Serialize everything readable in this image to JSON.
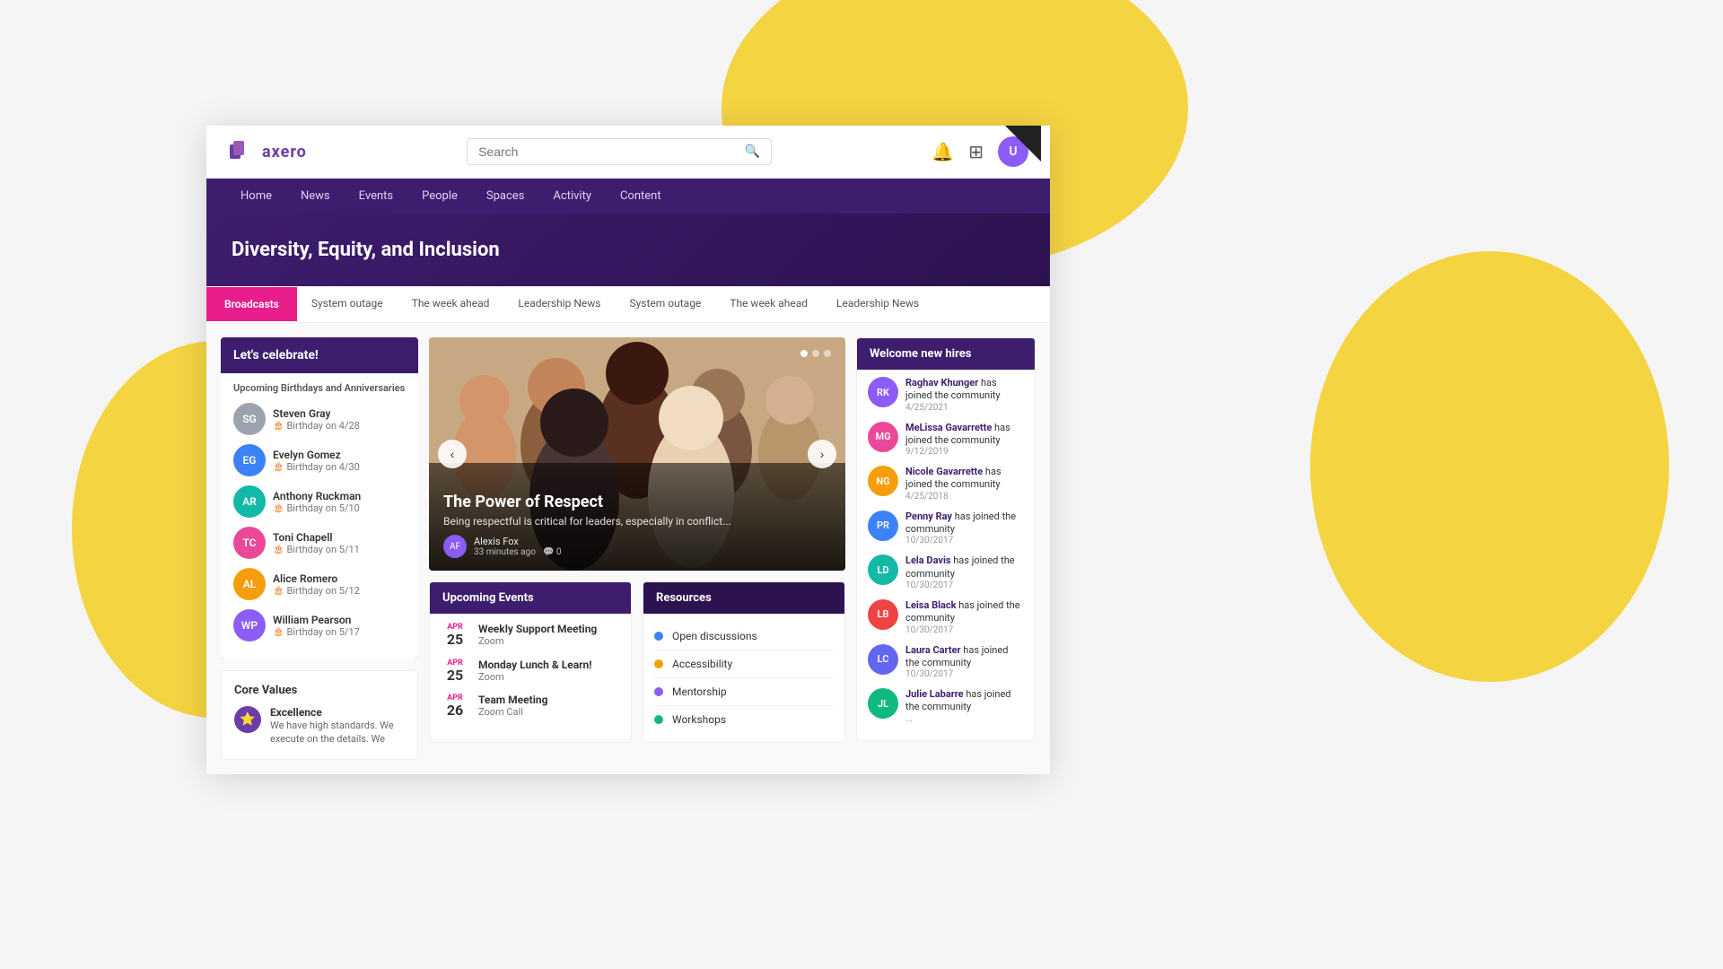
{
  "background": {
    "shape_top": "decorative yellow circle top",
    "shape_right": "decorative yellow blob right",
    "shape_left": "decorative yellow blob left"
  },
  "topbar": {
    "logo_text": "axero",
    "search_placeholder": "Search",
    "search_label": "Search",
    "notification_icon": "bell-icon",
    "add_icon": "add-icon",
    "user_avatar": "user-avatar"
  },
  "navbar": {
    "items": [
      {
        "label": "Home",
        "href": "#"
      },
      {
        "label": "News",
        "href": "#"
      },
      {
        "label": "Events",
        "href": "#"
      },
      {
        "label": "People",
        "href": "#"
      },
      {
        "label": "Spaces",
        "href": "#"
      },
      {
        "label": "Activity",
        "href": "#"
      },
      {
        "label": "Content",
        "href": "#"
      }
    ]
  },
  "hero": {
    "title": "Diversity, Equity, and Inclusion"
  },
  "broadcasts_bar": {
    "tabs": [
      {
        "label": "Broadcasts",
        "active": true
      },
      {
        "label": "System outage",
        "active": false
      },
      {
        "label": "The week ahead",
        "active": false
      },
      {
        "label": "Leadership News",
        "active": false
      },
      {
        "label": "System outage",
        "active": false
      },
      {
        "label": "The week ahead",
        "active": false
      },
      {
        "label": "Leadership News",
        "active": false
      }
    ]
  },
  "celebrate_card": {
    "title": "Let's celebrate!",
    "subtitle": "Upcoming Birthdays and Anniversaries",
    "birthdays": [
      {
        "name": "Steven Gray",
        "date": "Birthday on 4/28",
        "initials": "SG",
        "color": "av-gray"
      },
      {
        "name": "Evelyn Gomez",
        "date": "Birthday on 4/30",
        "initials": "EG",
        "color": "av-blue"
      },
      {
        "name": "Anthony Ruckman",
        "date": "Birthday on 5/10",
        "initials": "AR",
        "color": "av-teal"
      },
      {
        "name": "Toni Chapell",
        "date": "Birthday on 5/11",
        "initials": "TC",
        "color": "av-pink"
      },
      {
        "name": "Alice Romero",
        "date": "Birthday on 5/12",
        "initials": "AL",
        "color": "av-orange"
      },
      {
        "name": "William Pearson",
        "date": "Birthday on 5/17",
        "initials": "WP",
        "color": "av-purple"
      }
    ]
  },
  "core_values": {
    "title": "Core Values",
    "item": {
      "name": "Excellence",
      "description": "We have high standards. We execute on the details. We"
    }
  },
  "carousel": {
    "title": "The Power of Respect",
    "description": "Being respectful is critical for leaders, especially in conflict...",
    "author": "Alexis Fox",
    "time_ago": "33 minutes ago",
    "comments": "0",
    "dots": [
      true,
      false,
      false
    ]
  },
  "upcoming_events": {
    "title": "Upcoming Events",
    "events": [
      {
        "month": "APR",
        "day": "25",
        "name": "Weekly Support Meeting",
        "location": "Zoom"
      },
      {
        "month": "APR",
        "day": "25",
        "name": "Monday Lunch & Learn!",
        "location": "Zoom"
      },
      {
        "month": "APR",
        "day": "26",
        "name": "Team Meeting",
        "location": "Zoom Call"
      }
    ]
  },
  "resources": {
    "title": "Resources",
    "items": [
      {
        "label": "Open discussions",
        "color": "#3b82f6"
      },
      {
        "label": "Accessibility",
        "color": "#f59e0b"
      },
      {
        "label": "Mentorship",
        "color": "#8b5cf6"
      },
      {
        "label": "Workshops",
        "color": "#10b981"
      }
    ]
  },
  "new_hires": {
    "title": "Welcome new hires",
    "hires": [
      {
        "name": "Raghav Khunger",
        "action": "has joined the community",
        "date": "4/25/2021",
        "initials": "RK",
        "color": "av-purple"
      },
      {
        "name": "MeLissa Gavarrette",
        "action": "has joined the community",
        "date": "9/12/2019",
        "initials": "MG",
        "color": "av-pink"
      },
      {
        "name": "Nicole Gavarrette",
        "action": "has joined the community",
        "date": "4/25/2018",
        "initials": "NG",
        "color": "av-orange"
      },
      {
        "name": "Penny Ray",
        "action": "has joined the community",
        "date": "10/30/2017",
        "initials": "PR",
        "color": "av-blue"
      },
      {
        "name": "Lela Davis",
        "action": "has joined the community",
        "date": "10/30/2017",
        "initials": "LD",
        "color": "av-teal"
      },
      {
        "name": "Leisa Black",
        "action": "has joined the community",
        "date": "10/30/2017",
        "initials": "LB",
        "color": "av-red"
      },
      {
        "name": "Laura Carter",
        "action": "has joined the community",
        "date": "10/30/2017",
        "initials": "LC",
        "color": "av-indigo"
      },
      {
        "name": "Julie Labarre",
        "action": "has joined the community",
        "date": "...",
        "initials": "JL",
        "color": "av-green"
      }
    ]
  }
}
